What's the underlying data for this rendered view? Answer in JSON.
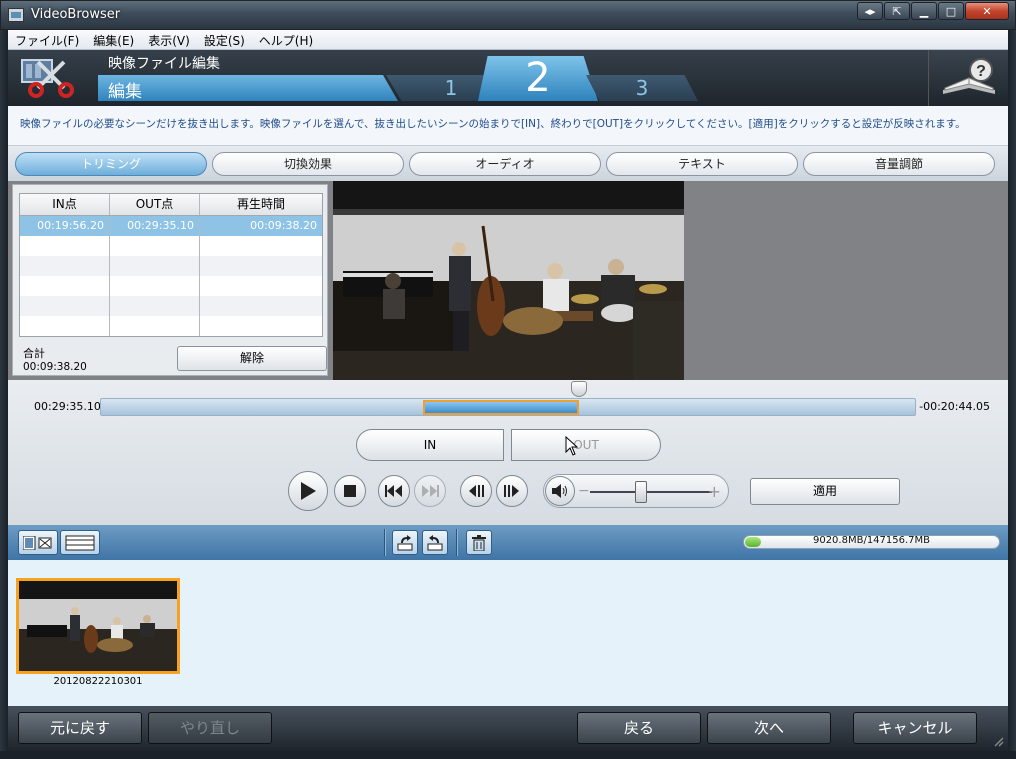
{
  "window": {
    "title": "VideoBrowser"
  },
  "menu": [
    "ファイル(F)",
    "編集(E)",
    "表示(V)",
    "設定(S)",
    "ヘルプ(H)"
  ],
  "header": {
    "subtitle": "映像ファイル編集",
    "title": "編集",
    "steps": [
      "1",
      "2",
      "3"
    ],
    "active_step": "2"
  },
  "instructions": "映像ファイルの必要なシーンだけを抜き出します。映像ファイルを選んで、抜き出したいシーンの始まりで[IN]、終わりで[OUT]をクリックしてください。[適用]をクリックすると設定が反映されます。",
  "tabs": [
    "トリミング",
    "切換効果",
    "オーディオ",
    "テキスト",
    "音量調節"
  ],
  "active_tab": "トリミング",
  "trim_table": {
    "columns": [
      "IN点",
      "OUT点",
      "再生時間"
    ],
    "rows": [
      [
        "00:19:56.20",
        "00:29:35.10",
        "00:09:38.20"
      ]
    ]
  },
  "total": {
    "label": "合計",
    "value": "00:09:38.20"
  },
  "clear_button": "解除",
  "timeline": {
    "start_time": "00:29:35.10",
    "end_time": "-00:20:44.05"
  },
  "in_button": "IN",
  "out_button": "OUT",
  "apply_button": "適用",
  "volume": {
    "minus": "−",
    "plus": "+"
  },
  "disk_usage": {
    "text": "9020.8MB/147156.7MB",
    "fraction": 0.0613
  },
  "thumbnail": {
    "label": "20120822210301"
  },
  "footer": {
    "undo": "元に戻す",
    "redo": "やり直し",
    "back": "戻る",
    "next": "次へ",
    "cancel": "キャンセル"
  },
  "colors": {
    "accent": "#2f83bd",
    "selection": "#f7a21c",
    "disk_fill": "#5bb22f"
  }
}
